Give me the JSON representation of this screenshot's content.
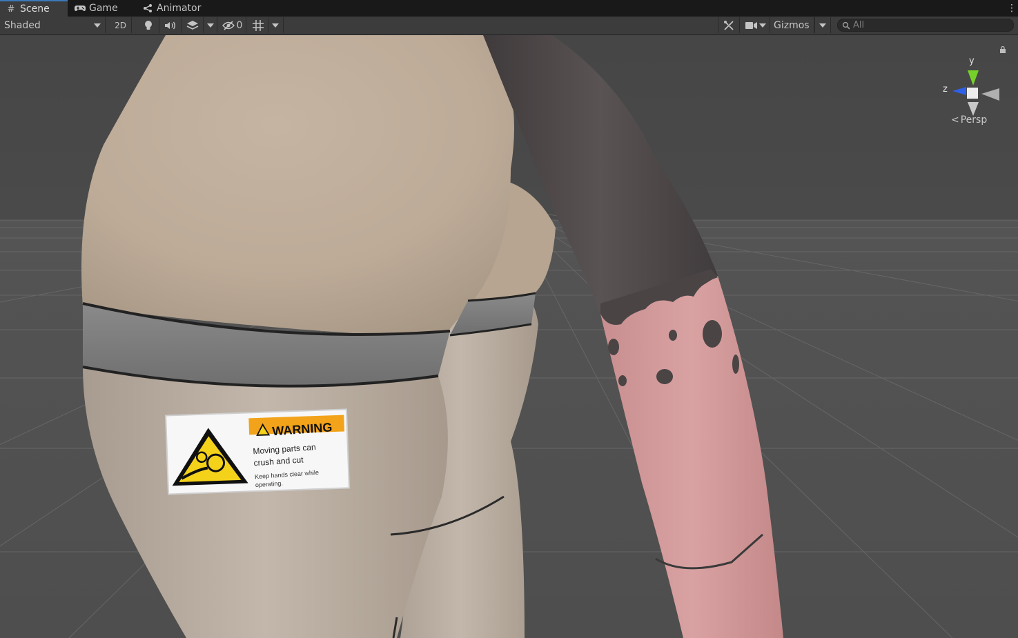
{
  "tabs": [
    {
      "label": "Scene",
      "icon": "grid-hash-icon",
      "active": true
    },
    {
      "label": "Game",
      "icon": "gamepad-icon",
      "active": false
    },
    {
      "label": "Animator",
      "icon": "animator-icon",
      "active": false
    }
  ],
  "toolbar": {
    "draw_mode": "Shaded",
    "toggle_2d": "2D",
    "hidden_count": "0",
    "gizmos_label": "Gizmos",
    "search_placeholder": "All"
  },
  "gizmo": {
    "y_label": "y",
    "z_label": "z",
    "projection": "Persp"
  },
  "sticker": {
    "heading": "WARNING",
    "line1": "Moving parts can",
    "line2": "crush and cut",
    "line3": "Keep hands clear while",
    "line4": "operating."
  },
  "colors": {
    "accent_tab": "#3a79bb",
    "toolbar_bg": "#3c3c3c",
    "scene_bg": "#505050",
    "warning_orange": "#f2a31a",
    "warning_yellow": "#f5d21a"
  }
}
